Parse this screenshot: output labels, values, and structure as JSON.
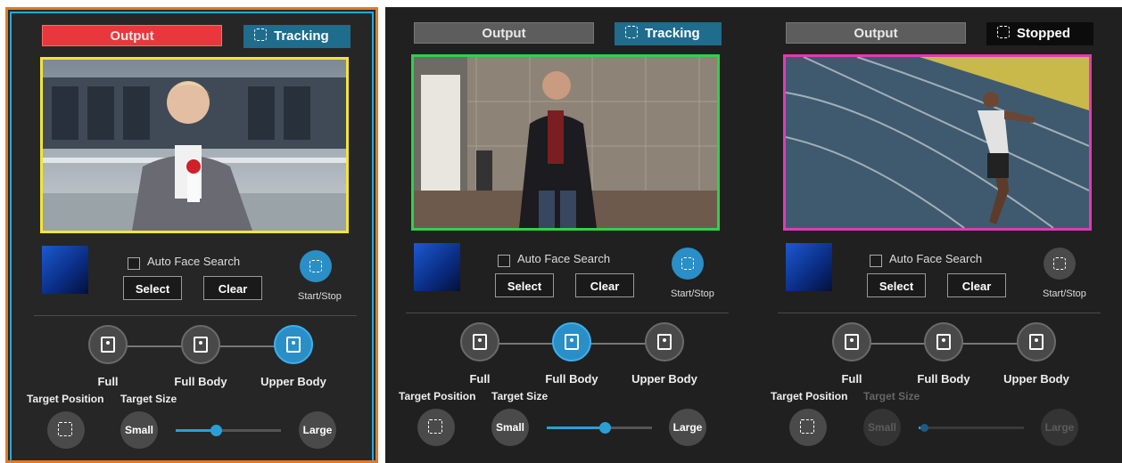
{
  "panels": [
    {
      "output_label": "Output",
      "tracking_label": "Tracking",
      "auto_face_search_label": "Auto Face Search",
      "select_label": "Select",
      "clear_label": "Clear",
      "start_stop_label": "Start/Stop",
      "modes": [
        "Full",
        "Full Body",
        "Upper Body"
      ],
      "selected_mode": "Upper Body",
      "target_position_label": "Target Position",
      "target_size_label": "Target Size",
      "small_label": "Small",
      "large_label": "Large",
      "target_size_slider": 0.38,
      "frame_color": "#f2e43a",
      "output_color": "#e8383d",
      "tracking_color": "#1f6c8d"
    },
    {
      "output_label": "Output",
      "tracking_label": "Tracking",
      "auto_face_search_label": "Auto Face Search",
      "select_label": "Select",
      "clear_label": "Clear",
      "start_stop_label": "Start/Stop",
      "modes": [
        "Full",
        "Full Body",
        "Upper Body"
      ],
      "selected_mode": "Full Body",
      "target_position_label": "Target Position",
      "target_size_label": "Target Size",
      "small_label": "Small",
      "large_label": "Large",
      "target_size_slider": 0.55,
      "frame_color": "#2fd14a",
      "output_color": "#5d5d5d",
      "tracking_color": "#1f6c8d"
    },
    {
      "output_label": "Output",
      "tracking_label": "Stopped",
      "auto_face_search_label": "Auto Face Search",
      "select_label": "Select",
      "clear_label": "Clear",
      "start_stop_label": "Start/Stop",
      "modes": [
        "Full",
        "Full Body",
        "Upper Body"
      ],
      "selected_mode": "none",
      "target_position_label": "Target Position",
      "target_size_label": "Target Size",
      "small_label": "Small",
      "large_label": "Large",
      "target_size_slider": 0.05,
      "frame_color": "#e03ab8",
      "output_color": "#5d5d5d",
      "tracking_color": "#0c0c0c"
    }
  ],
  "icons": {
    "tracking": "tracking-frame-icon",
    "start_stop": "tracking-frame-icon",
    "full": "full-frame-person-icon",
    "full_body": "full-body-icon",
    "upper_body": "upper-body-icon",
    "target_position": "target-position-icon"
  }
}
